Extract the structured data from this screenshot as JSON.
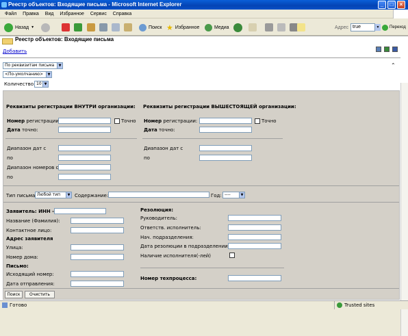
{
  "window": {
    "title": "Реестр объектов: Входящие письма - Microsoft Internet Explorer"
  },
  "menu": [
    "Файл",
    "Правка",
    "Вид",
    "Избранное",
    "Сервис",
    "Справка"
  ],
  "toolbar": {
    "back": "Назад",
    "search": "Поиск",
    "favorites": "Избранное",
    "media": "Медиа",
    "address_label": "Адрес",
    "address_value": "true",
    "go": "Переход"
  },
  "page": {
    "title": "Реестр объектов: Входящие письма",
    "add_link": "Добавить"
  },
  "controls": {
    "filter_select": "По реквизитам письма",
    "sort_select": "<По-умолчанию>",
    "count_label": "Количество:",
    "count_value": "10"
  },
  "form": {
    "inside_header": "Реквизиты регистрации ВНУТРИ организации:",
    "higher_header": "Реквизиты регистрации ВЫШЕСТОЯЩЕЙ организации:",
    "reg_number_bold": "Номер",
    "reg_number_rest": "регистрации:",
    "exact": "Точно",
    "date_bold": "Дата",
    "date_rest": "точно:",
    "date_range": "Диапазон дат с",
    "to": "по",
    "number_range": "Диапазон номеров с",
    "letter_type_label": "Тип письма:",
    "letter_type_value": "Любой тип",
    "content_label": "Содержание:",
    "year_label": "Год:",
    "year_value": "----",
    "applicant_inn": "Заявитель: ИНН -",
    "name": "Название (Фамилия):",
    "contact": "Контактное лицо:",
    "address_header": "Адрес заявителя",
    "street": "Улица:",
    "house": "Номер дома:",
    "letter_header": "Письмо:",
    "outgoing_number": "Исходящий номер:",
    "send_date": "Дата отправления:",
    "resolution_header": "Резолюция:",
    "head": "Руководитель:",
    "responsible": "Ответств. исполнитель:",
    "dept_head": "Нач. подразделения:",
    "resolution_date": "Дата резолюции в подразделении:",
    "has_executor": "Наличие исполнителя(-лей)",
    "techprocess": "Номер техпроцесса:",
    "search_button": "Поиск",
    "clear_button": "Очистить"
  },
  "status": {
    "left": "Готово",
    "zone": "Trusted sites"
  }
}
